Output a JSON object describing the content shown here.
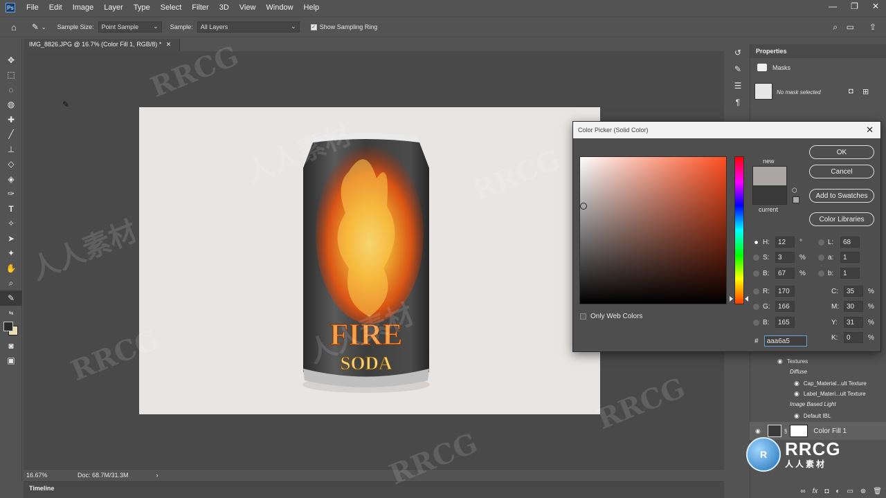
{
  "colors": {
    "app_bg": "#535353",
    "doc_bg": "#e8e5e2",
    "new_color": "#aaa6a5",
    "current_color": "#3a3a3a",
    "hue_color": "#ff4e1f"
  },
  "menubar": {
    "logo": "Ps",
    "items": [
      "File",
      "Edit",
      "Image",
      "Layer",
      "Type",
      "Select",
      "Filter",
      "3D",
      "View",
      "Window",
      "Help"
    ]
  },
  "options": {
    "sample_size_label": "Sample Size:",
    "sample_size_value": "Point Sample",
    "sample_label": "Sample:",
    "sample_value": "All Layers",
    "show_ring_label": "Show Sampling Ring",
    "show_ring_checked": true
  },
  "document": {
    "tab_title": "IMG_8826.JPG @ 16.7% (Color Fill 1, RGB/8) *",
    "zoom": "16.67%",
    "doc_size": "Doc: 68.7M/31.3M"
  },
  "can": {
    "line1": "FIRE",
    "line2": "SODA"
  },
  "timeline_label": "Timeline",
  "properties": {
    "title": "Properties",
    "masks_label": "Masks",
    "no_mask": "No mask selected"
  },
  "layers": {
    "textures": "Textures",
    "diffuse": "Diffuse",
    "cap_texture": "Cap_Material...ult Texture",
    "label_texture": "Label_Materi...ult Texture",
    "ibl": "Image Based Light",
    "default_ibl": "Default IBL",
    "color_fill": "Color Fill 1"
  },
  "color_picker": {
    "title": "Color Picker (Solid Color)",
    "new_label": "new",
    "current_label": "current",
    "buttons": {
      "ok": "OK",
      "cancel": "Cancel",
      "add_swatches": "Add to Swatches",
      "libraries": "Color Libraries"
    },
    "only_web": "Only Web Colors",
    "hsb": {
      "h": "12",
      "s": "3",
      "b": "67"
    },
    "rgb": {
      "r": "170",
      "g": "166",
      "b": "165"
    },
    "lab": {
      "l": "68",
      "a": "1",
      "b": "1"
    },
    "cmyk": {
      "c": "35",
      "m": "30",
      "y": "31",
      "k": "0"
    },
    "labels": {
      "h": "H:",
      "s": "S:",
      "b": "B:",
      "r": "R:",
      "g": "G:",
      "bb": "B:",
      "l": "L:",
      "a": "a:",
      "lb": "b:",
      "c": "C:",
      "m": "M:",
      "y": "Y:",
      "k": "K:"
    },
    "units": {
      "deg": "°",
      "pct": "%"
    },
    "hex_label": "#",
    "hex": "aaa6a5"
  },
  "watermark": {
    "brand": "RRCG",
    "cn": "人人素材"
  }
}
